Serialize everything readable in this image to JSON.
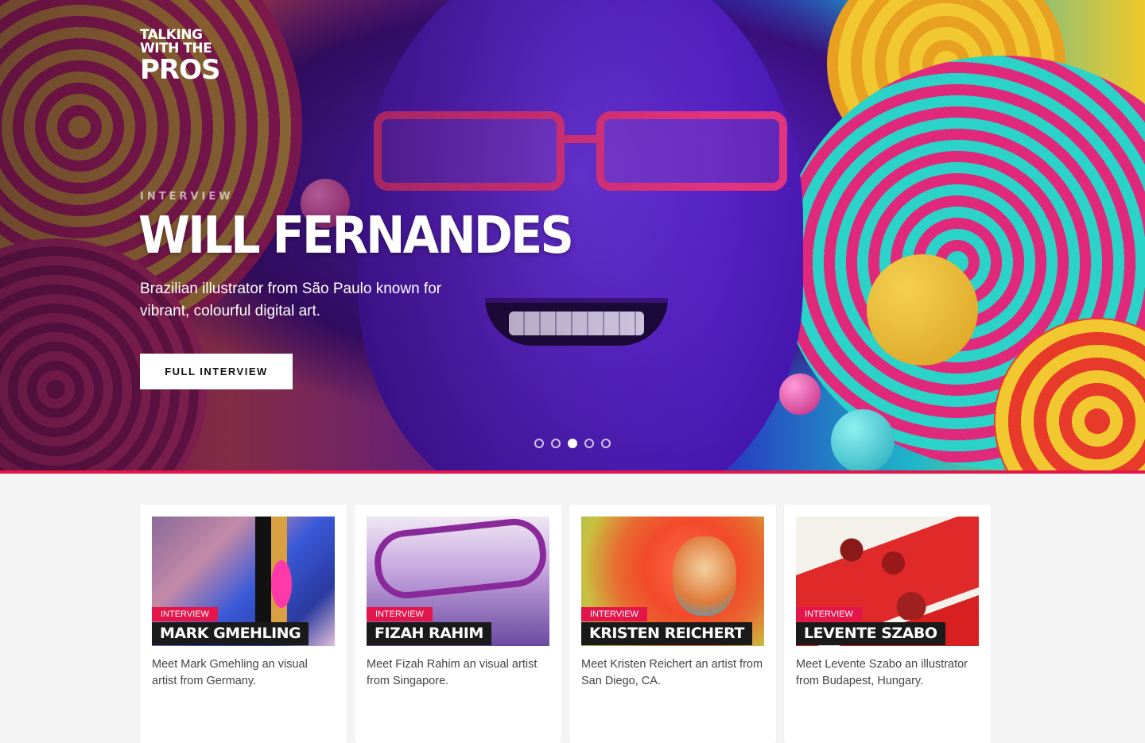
{
  "logo": {
    "line1": "TALKING",
    "line2": "WITH THE",
    "line3": "PROS"
  },
  "hero": {
    "kicker": "INTERVIEW",
    "title": "WILL FERNANDES",
    "description": "Brazilian illustrator from São Paulo known for vibrant, colourful digital art.",
    "button_label": "FULL INTERVIEW",
    "slides": 5,
    "active_slide": 3,
    "accent_color": "#e3154a"
  },
  "cards": [
    {
      "badge": "INTERVIEW",
      "name": "MARK GMEHLING",
      "description": "Meet Mark Gmehling an visual artist from Germany."
    },
    {
      "badge": "INTERVIEW",
      "name": "FIZAH RAHIM",
      "description": "Meet Fizah Rahim an visual artist from Singapore."
    },
    {
      "badge": "INTERVIEW",
      "name": "KRISTEN REICHERT",
      "description": "Meet Kristen Reichert an artist from San Diego, CA."
    },
    {
      "badge": "INTERVIEW",
      "name": "LEVENTE SZABO",
      "description": "Meet Levente Szabo an illustrator from Budapest, Hungary."
    }
  ]
}
